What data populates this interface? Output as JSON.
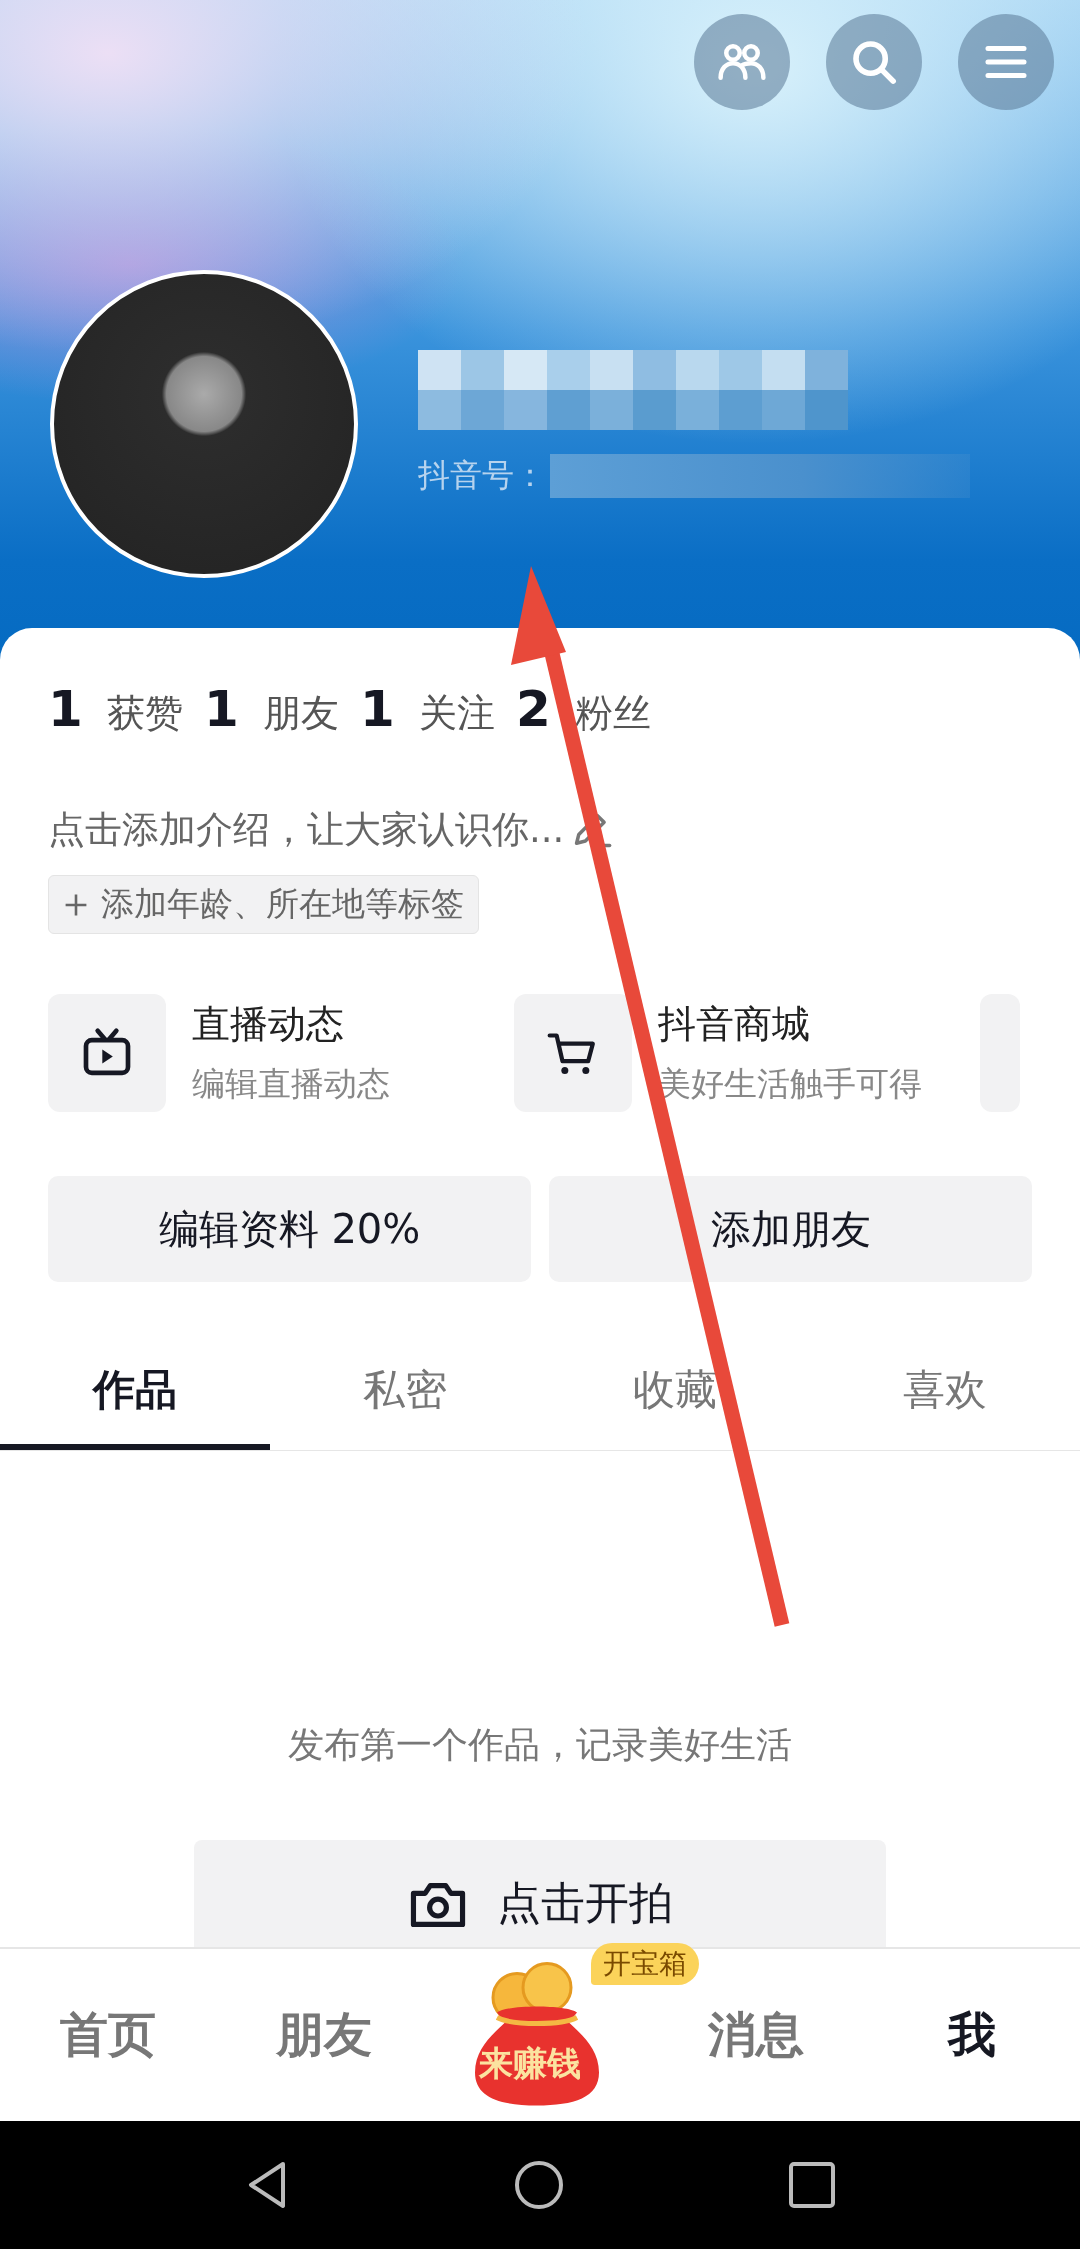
{
  "header": {
    "buttons": [
      {
        "kind": "friends"
      },
      {
        "kind": "search"
      },
      {
        "kind": "menu"
      }
    ],
    "id_label": "抖音号："
  },
  "stats": [
    {
      "count": "1",
      "label": "获赞"
    },
    {
      "count": "1",
      "label": "朋友"
    },
    {
      "count": "1",
      "label": "关注"
    },
    {
      "count": "2",
      "label": "粉丝"
    }
  ],
  "bio": {
    "text": "点击添加介绍，让大家认识你...",
    "tag": "添加年龄、所在地等标签"
  },
  "shortcuts": [
    {
      "kind": "live",
      "title": "直播动态",
      "subtitle": "编辑直播动态"
    },
    {
      "kind": "shop",
      "title": "抖音商城",
      "subtitle": "美好生活触手可得"
    }
  ],
  "actions": [
    "编辑资料 20%",
    "添加朋友"
  ],
  "tabs": [
    {
      "label": "作品",
      "selected": true
    },
    {
      "label": "私密",
      "selected": false
    },
    {
      "label": "收藏",
      "selected": false
    },
    {
      "label": "喜欢",
      "selected": false
    }
  ],
  "empty": {
    "message": "发布第一个作品，记录美好生活",
    "button": "点击开拍"
  },
  "bottom_nav": [
    {
      "kind": "text",
      "label": "首页",
      "selected": false
    },
    {
      "kind": "text",
      "label": "朋友",
      "selected": false
    },
    {
      "kind": "reward",
      "label": "来赚钱",
      "badge": "开宝箱"
    },
    {
      "kind": "text",
      "label": "消息",
      "selected": false
    },
    {
      "kind": "text",
      "label": "我",
      "selected": true
    }
  ]
}
